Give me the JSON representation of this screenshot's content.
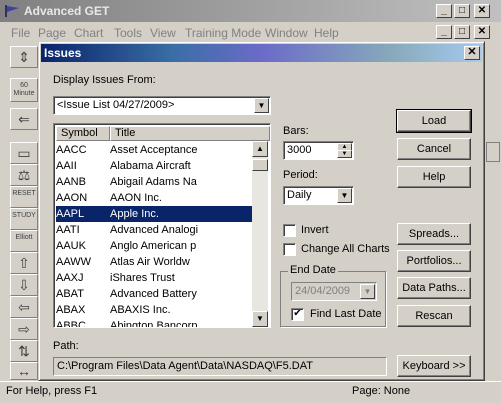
{
  "app": {
    "title": "Advanced GET",
    "menu": [
      "File",
      "Page",
      "Chart",
      "Tools",
      "View",
      "Training Mode",
      "Window",
      "Help"
    ],
    "status_left": "For Help, press F1",
    "status_right": "Page: None"
  },
  "toolbar": {
    "minus_label": "60 Minute",
    "study_label": "STUDY",
    "reset_label": "RESET",
    "elliott_label": "Elliott"
  },
  "dialog": {
    "title": "Issues",
    "display_from_label": "Display Issues From:",
    "issue_list_value": "<Issue List 04/27/2009>",
    "columns": [
      "Symbol",
      "Title"
    ],
    "rows": [
      {
        "symbol": "AACC",
        "title": "Asset Acceptance"
      },
      {
        "symbol": "AAII",
        "title": "Alabama Aircraft"
      },
      {
        "symbol": "AANB",
        "title": "Abigail Adams Na"
      },
      {
        "symbol": "AAON",
        "title": "AAON Inc."
      },
      {
        "symbol": "AAPL",
        "title": "Apple Inc."
      },
      {
        "symbol": "AATI",
        "title": "Advanced Analogi"
      },
      {
        "symbol": "AAUK",
        "title": "Anglo American p"
      },
      {
        "symbol": "AAWW",
        "title": "Atlas Air Worldw"
      },
      {
        "symbol": "AAXJ",
        "title": "iShares Trust"
      },
      {
        "symbol": "ABAT",
        "title": "Advanced Battery"
      },
      {
        "symbol": "ABAX",
        "title": "ABAXIS Inc."
      },
      {
        "symbol": "ABBC",
        "title": "Abington Bancorp"
      }
    ],
    "selected_symbol": "AAPL",
    "bars_label": "Bars:",
    "bars_value": "3000",
    "period_label": "Period:",
    "period_value": "Daily",
    "invert_label": "Invert",
    "invert_checked": false,
    "change_all_label": "Change All Charts",
    "change_all_checked": false,
    "end_date_label": "End Date",
    "end_date_value": "24/04/2009",
    "find_last_date_label": "Find Last Date",
    "find_last_date_checked": true,
    "path_label": "Path:",
    "path_value": "C:\\Program Files\\Data Agent\\Data\\NASDAQ\\F5.DAT",
    "buttons": {
      "load": "Load",
      "cancel": "Cancel",
      "help": "Help",
      "spreads": "Spreads...",
      "portfolios": "Portfolios...",
      "data_paths": "Data Paths...",
      "rescan": "Rescan",
      "keyboard": "Keyboard >>"
    }
  },
  "colors": {
    "selection": "#0a246a",
    "face": "#d4d0c8"
  }
}
